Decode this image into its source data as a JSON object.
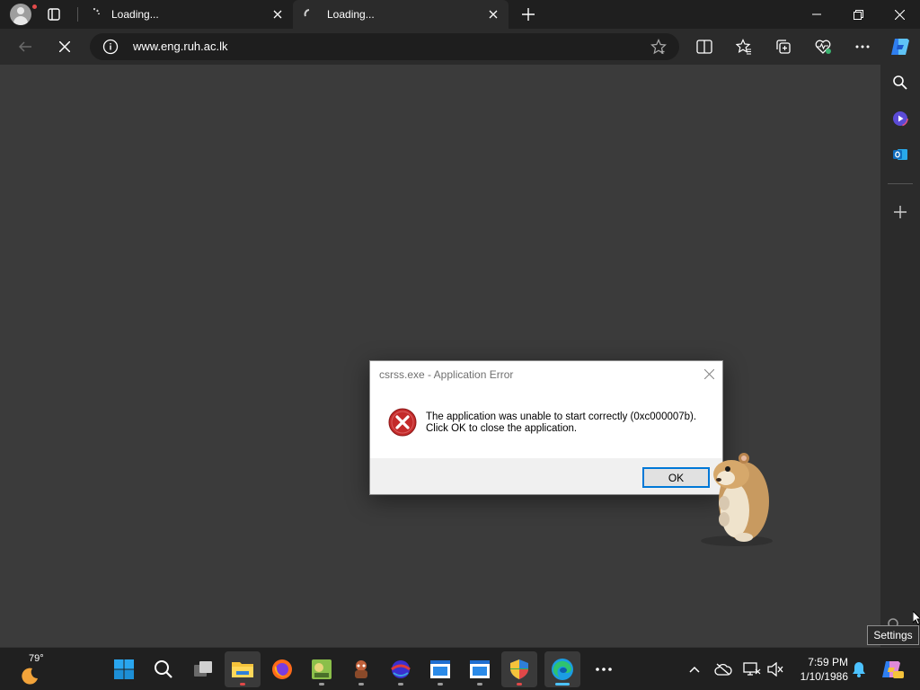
{
  "browser": {
    "tabs": [
      {
        "title": "Loading..."
      },
      {
        "title": "Loading..."
      }
    ],
    "address": {
      "url": "www.eng.ruh.ac.lk"
    }
  },
  "dialog": {
    "title": "csrss.exe - Application Error",
    "message_line1": "The application was unable to start correctly (0xc000007b).",
    "message_line2": "Click OK to close the application.",
    "ok_label": "OK"
  },
  "tooltip": {
    "text": "Settings"
  },
  "taskbar": {
    "weather_temp": "79°",
    "clock_time": "7:59 PM",
    "clock_date": "1/10/1986"
  },
  "colors": {
    "accent": "#0078d7",
    "error_red": "#c42b2b",
    "page_bg": "#3b3b3b"
  }
}
